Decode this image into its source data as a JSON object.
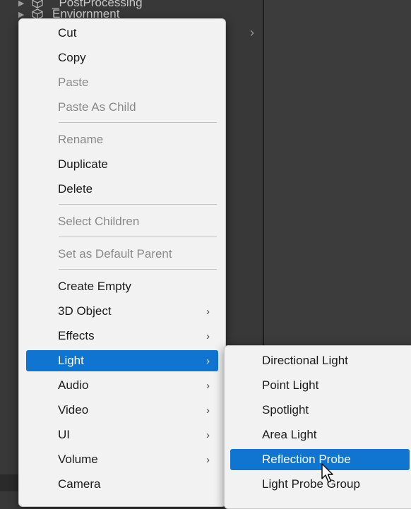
{
  "hierarchy": {
    "rows": [
      {
        "label": "_PostProcessing"
      },
      {
        "label": "Enviornment"
      }
    ]
  },
  "context_menu": {
    "items": [
      {
        "label": "Cut",
        "enabled": true
      },
      {
        "label": "Copy",
        "enabled": true
      },
      {
        "label": "Paste",
        "enabled": false
      },
      {
        "label": "Paste As Child",
        "enabled": false
      },
      {
        "label": "Rename",
        "enabled": false
      },
      {
        "label": "Duplicate",
        "enabled": true
      },
      {
        "label": "Delete",
        "enabled": true
      },
      {
        "label": "Select Children",
        "enabled": false
      },
      {
        "label": "Set as Default Parent",
        "enabled": false
      },
      {
        "label": "Create Empty",
        "enabled": true
      },
      {
        "label": "3D Object",
        "enabled": true,
        "submenu": true
      },
      {
        "label": "Effects",
        "enabled": true,
        "submenu": true
      },
      {
        "label": "Light",
        "enabled": true,
        "submenu": true,
        "active": true
      },
      {
        "label": "Audio",
        "enabled": true,
        "submenu": true
      },
      {
        "label": "Video",
        "enabled": true,
        "submenu": true
      },
      {
        "label": "UI",
        "enabled": true,
        "submenu": true
      },
      {
        "label": "Volume",
        "enabled": true,
        "submenu": true
      },
      {
        "label": "Camera",
        "enabled": true
      }
    ],
    "submenu_arrow": "›"
  },
  "light_submenu": {
    "items": [
      {
        "label": "Directional Light"
      },
      {
        "label": "Point Light"
      },
      {
        "label": "Spotlight"
      },
      {
        "label": "Area Light"
      },
      {
        "label": "Reflection Probe",
        "active": true
      },
      {
        "label": "Light Probe Group"
      }
    ]
  },
  "colors": {
    "highlight": "#0f75d0",
    "menu_bg": "#f2f2f2",
    "disabled_text": "#8a8a8a",
    "panel_bg": "#383838"
  },
  "icons": {
    "hierarchy_row_icon": "cube-icon",
    "expand_icon": "triangle-right-icon",
    "submenu_icon": "chevron-right-icon",
    "pointer": "mouse-cursor-icon"
  }
}
